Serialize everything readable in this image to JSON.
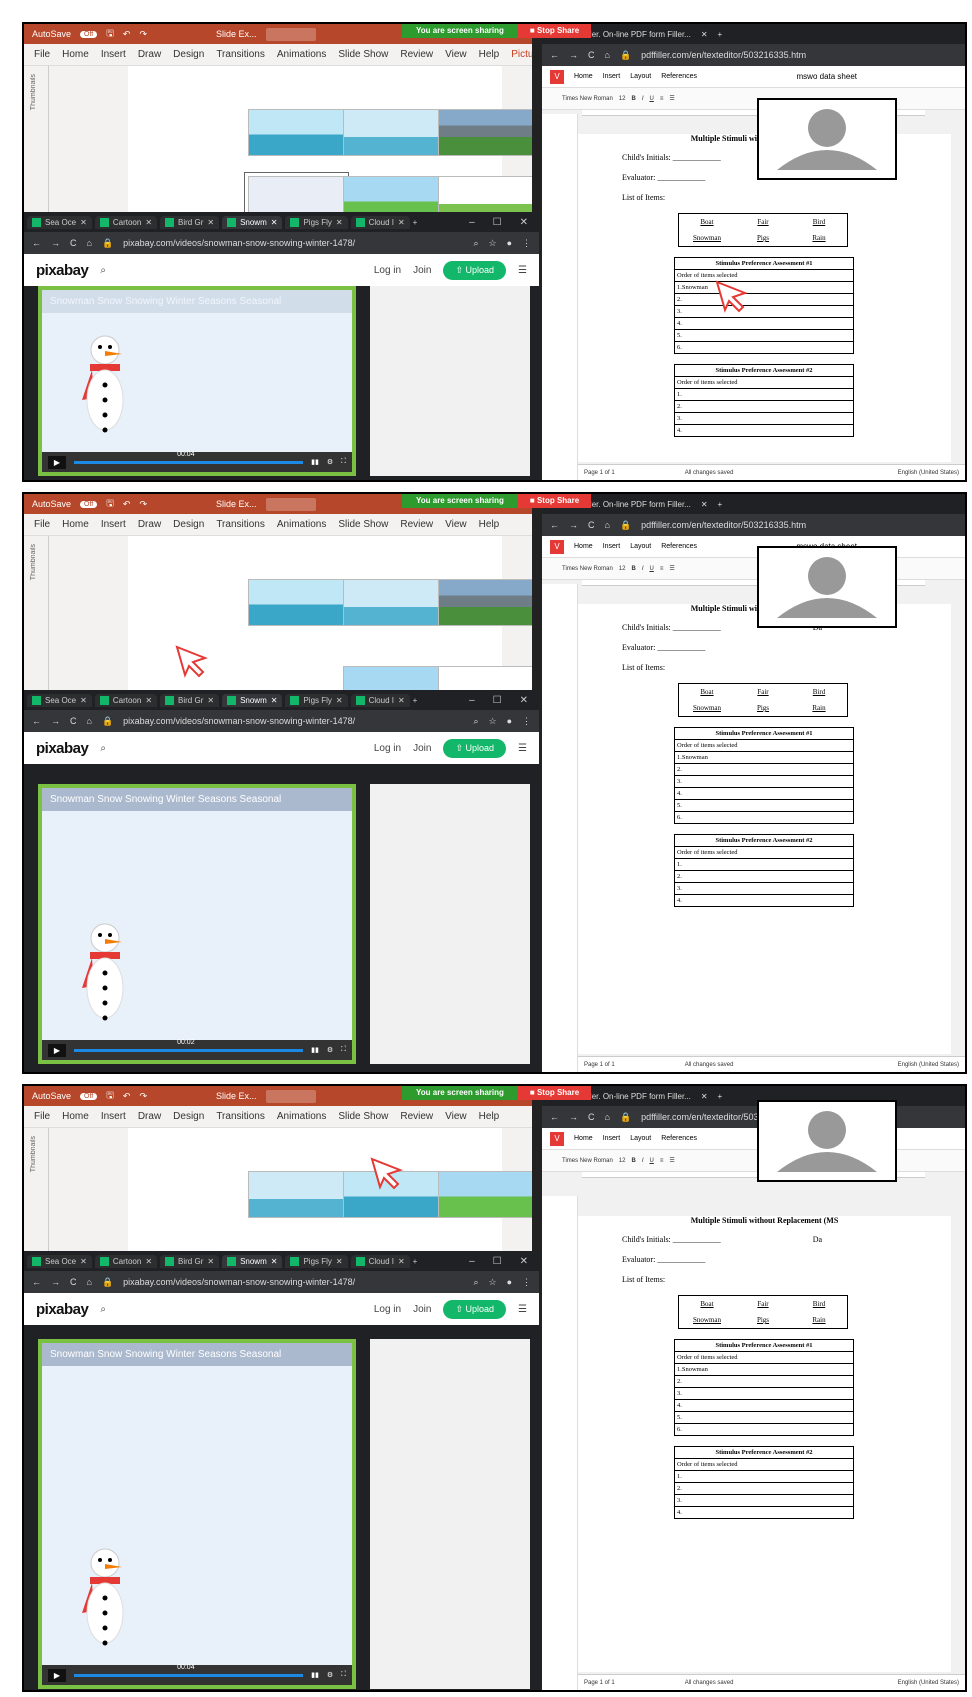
{
  "powerpoint": {
    "autosave": "AutoSave",
    "autosave_state": "Off",
    "filename": "Slide Ex...",
    "menu": [
      "File",
      "Home",
      "Insert",
      "Draw",
      "Design",
      "Transitions",
      "Animations",
      "Slide Show",
      "Review",
      "View",
      "Help"
    ],
    "picture_format": "Picture Format",
    "thumbnails_label": "Thumbnails"
  },
  "chrome_tabs": [
    "Sea Oce",
    "Cartoon",
    "Bird Gr",
    "Snowm",
    "Pigs Fly",
    "Cloud I"
  ],
  "pixabay": {
    "url": "pixabay.com/videos/snowman-snow-snowing-winter-1478/",
    "logo": "pixabay",
    "login": "Log in",
    "join": "Join",
    "upload": "Upload",
    "video_tags": "Snowman  Snow  Snowing  Winter  Seasons  Seasonal",
    "times": [
      "00:04",
      "00:02",
      "00:04"
    ]
  },
  "pdf": {
    "tab": "PDFfiller. On-line PDF form Filler...",
    "url": "pdffiller.com/en/texteditor/503216335.htm",
    "ribbon": [
      "Home",
      "Insert",
      "Layout",
      "References"
    ],
    "doc_title": "mswo data sheet",
    "font": "Times New Roman",
    "size": "12",
    "heading": "Multiple Stimuli without Replacement (MS",
    "child": "Child's Initials: ____________",
    "date": "Da",
    "evaluator": "Evaluator: ____________",
    "list": "List of Items:",
    "items": [
      "Boat",
      "Fair",
      "Bird",
      "Snowman",
      "Pigs",
      "Rain"
    ],
    "spa1": "Stimulus Preference Assessment #1",
    "spa2": "Stimulus Preference Assessment #2",
    "order": "Order of items selected",
    "rows1": [
      "1.Snowman",
      "2.",
      "3.",
      "4.",
      "5.",
      "6."
    ],
    "rows2": [
      "1.",
      "2.",
      "3.",
      "4."
    ],
    "page_num": "Page 1 of 1",
    "saved": "All changes saved",
    "lang": "English (United States)"
  },
  "share": {
    "sharing": "You are screen sharing",
    "stop": "Stop Share"
  }
}
